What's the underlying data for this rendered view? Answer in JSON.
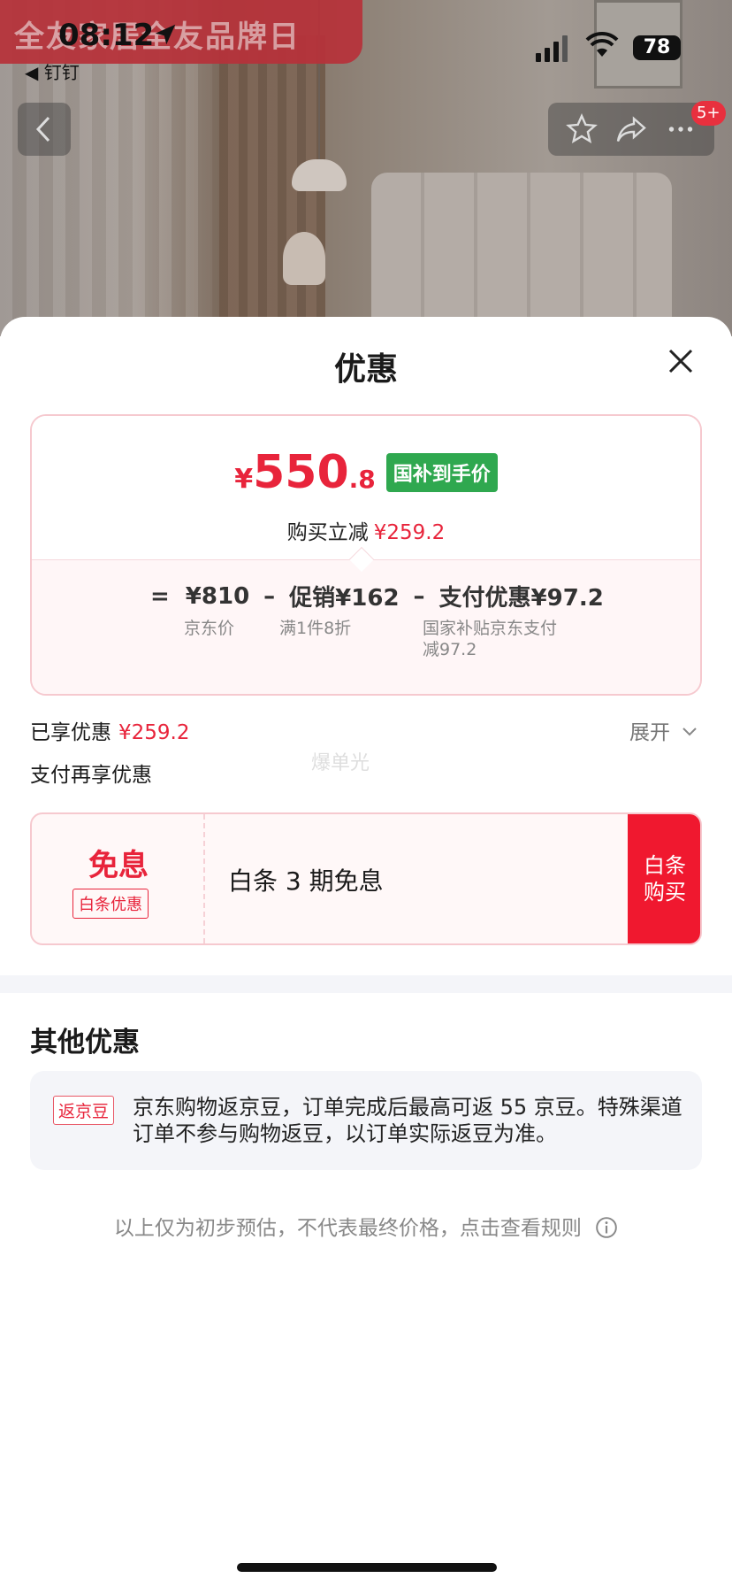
{
  "status_bar": {
    "time": "08:12",
    "back_app": "◀ 钉钉",
    "battery": "78"
  },
  "banner": {
    "text": "全友家居全友品牌日"
  },
  "nav": {
    "badge": "5+"
  },
  "sheet": {
    "title": "优惠",
    "price_card": {
      "currency": "¥",
      "price_int": "550",
      "price_dec": ".8",
      "tag": "国补到手价",
      "save_label": "购买立减",
      "save_amount": "¥259.2",
      "calc": {
        "eq": "=",
        "jd_price": "¥810",
        "jd_price_label": "京东价",
        "minus1": "–",
        "promo": "促销¥162",
        "promo_label": "满1件8折",
        "minus2": "–",
        "pay": "支付优惠¥97.2",
        "pay_label_1": "国家补贴京东支付",
        "pay_label_2": "减97.2"
      }
    },
    "enjoyed": {
      "label": "已享优惠",
      "amount": "¥259.2",
      "expand": "展开"
    },
    "pay_more": "支付再享优惠",
    "watermark": "爆单光",
    "coupon": {
      "title": "免息",
      "tag": "白条优惠",
      "text": "白条 3 期免息",
      "button": "白条购买"
    },
    "other": {
      "title": "其他优惠",
      "tag": "返京豆",
      "text": "京东购物返京豆，订单完成后最高可返 55 京豆。特殊渠道订单不参与购物返豆，以订单实际返豆为准。"
    },
    "footnote": "以上仅为初步预估，不代表最终价格，点击查看规则"
  },
  "colors": {
    "accent": "#e8243b",
    "green_tag": "#2fa84f",
    "button": "#f0182f"
  }
}
